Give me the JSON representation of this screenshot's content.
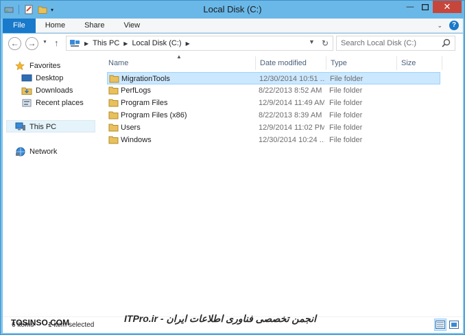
{
  "window": {
    "title": "Local Disk (C:)",
    "minimize_glyph": "—",
    "maximize_glyph": "☐",
    "close_glyph": "✕"
  },
  "ribbon": {
    "tabs": [
      {
        "label": "File"
      },
      {
        "label": "Home"
      },
      {
        "label": "Share"
      },
      {
        "label": "View"
      }
    ],
    "help_glyph": "?"
  },
  "address": {
    "crumbs": [
      "This PC",
      "Local Disk (C:)"
    ],
    "search_placeholder": "Search Local Disk (C:)"
  },
  "nav": {
    "favorites": "Favorites",
    "desktop": "Desktop",
    "downloads": "Downloads",
    "recent": "Recent places",
    "thispc": "This PC",
    "network": "Network"
  },
  "columns": {
    "name": "Name",
    "date": "Date modified",
    "type": "Type",
    "size": "Size"
  },
  "files": [
    {
      "name": "MigrationTools",
      "date": "12/30/2014 10:51 ...",
      "type": "File folder",
      "selected": true
    },
    {
      "name": "PerfLogs",
      "date": "8/22/2013 8:52 AM",
      "type": "File folder",
      "selected": false
    },
    {
      "name": "Program Files",
      "date": "12/9/2014 11:49 AM",
      "type": "File folder",
      "selected": false
    },
    {
      "name": "Program Files (x86)",
      "date": "8/22/2013 8:39 AM",
      "type": "File folder",
      "selected": false
    },
    {
      "name": "Users",
      "date": "12/9/2014 11:02 PM",
      "type": "File folder",
      "selected": false
    },
    {
      "name": "Windows",
      "date": "12/30/2014 10:24 ...",
      "type": "File folder",
      "selected": false
    }
  ],
  "status": {
    "items": "6 items",
    "selected": "1 item selected"
  },
  "watermark": {
    "site": "TOSINSO.COM",
    "text": "ITPro.ir - انجمن تخصصی فناوری اطلاعات ایران"
  },
  "colors": {
    "accent": "#1979ca",
    "titlebar": "#6ab8e8",
    "selection": "#cce8ff",
    "close": "#c7463c",
    "folder": "#e8c15d"
  }
}
